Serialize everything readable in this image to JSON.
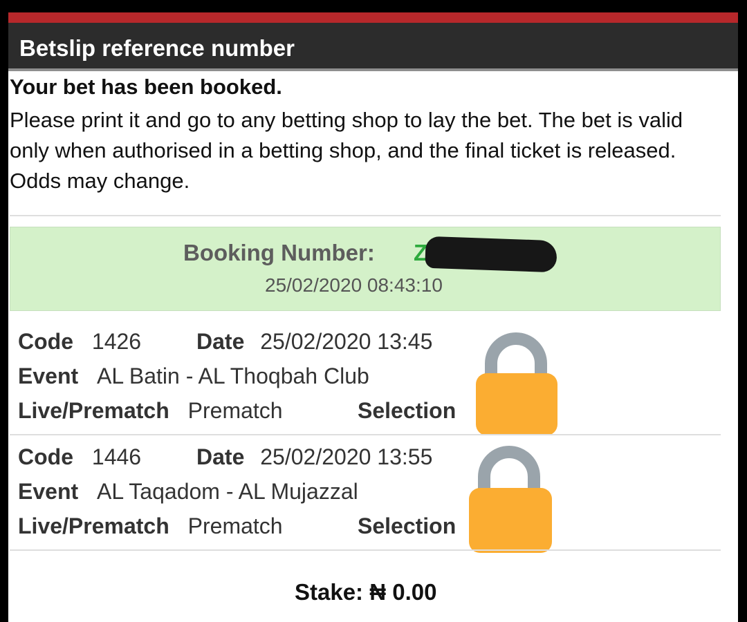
{
  "header": {
    "title": "Betslip reference number"
  },
  "message": {
    "title": "Your bet has been booked.",
    "body": "Please print it and go to any betting shop to lay the bet. The bet is valid only when authorised in a betting shop, and the final ticket is released. Odds may change."
  },
  "booking": {
    "label": "Booking Number:",
    "number_visible": "Z",
    "timestamp": "25/02/2020 08:43:10"
  },
  "labels": {
    "code": "Code",
    "date": "Date",
    "event": "Event",
    "live_prematch": "Live/Prematch",
    "selection": "Selection"
  },
  "bets": [
    {
      "code": "1426",
      "date": "25/02/2020 13:45",
      "event": "AL Batin - AL Thoqbah Club",
      "type": "Prematch",
      "selection_icon": "lock-icon"
    },
    {
      "code": "1446",
      "date": "25/02/2020 13:55",
      "event": "AL Taqadom - AL Mujazzal",
      "type": "Prematch",
      "selection_icon": "lock-icon"
    }
  ],
  "stake": {
    "label": "Stake:",
    "value": "₦ 0.00"
  },
  "colors": {
    "accent": "#b7282b",
    "header_bg": "#2c2c2c",
    "booking_bg": "#d4f1c9",
    "booking_number": "#2eaa3e",
    "lock_body": "#fbad32",
    "lock_shackle": "#9aa4ab"
  }
}
